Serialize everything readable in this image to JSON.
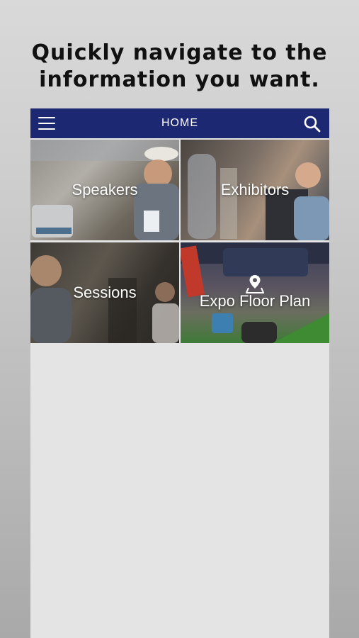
{
  "headline": {
    "line1": "Quickly navigate to the",
    "line2": "information you want."
  },
  "navbar": {
    "title": "HOME",
    "menu_icon": "hamburger-menu-icon",
    "search_icon": "search-icon",
    "background": "#1d2873"
  },
  "tiles": [
    {
      "label": "Speakers"
    },
    {
      "label": "Exhibitors"
    },
    {
      "label": "Sessions"
    },
    {
      "label": "Expo Floor Plan",
      "icon": "map-pin-icon"
    }
  ]
}
